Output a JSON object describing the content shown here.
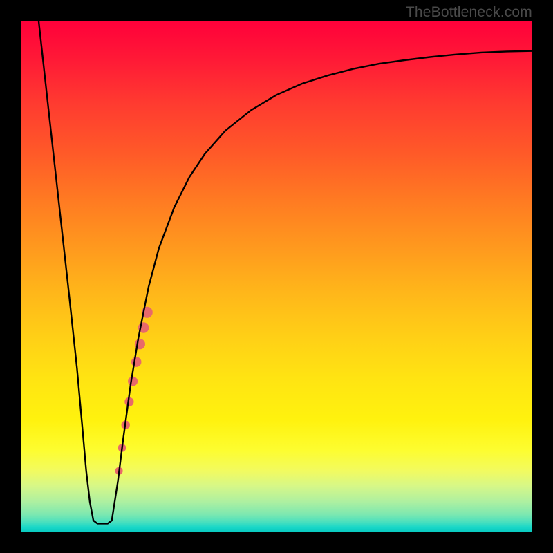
{
  "watermark": "TheBottleneck.com",
  "chart_data": {
    "type": "line",
    "title": "",
    "xlabel": "",
    "ylabel": "",
    "xlim": [
      0,
      100
    ],
    "ylim": [
      0,
      100
    ],
    "series": [
      {
        "name": "curve",
        "points": [
          [
            3.5,
            100
          ],
          [
            5.5,
            82
          ],
          [
            7.5,
            64
          ],
          [
            9.5,
            46
          ],
          [
            11,
            32
          ],
          [
            12,
            21
          ],
          [
            12.8,
            12
          ],
          [
            13.5,
            6
          ],
          [
            14.2,
            2.3
          ],
          [
            15,
            1.7
          ],
          [
            16,
            1.7
          ],
          [
            17,
            1.7
          ],
          [
            17.8,
            2.3
          ],
          [
            19,
            10
          ],
          [
            20,
            18
          ],
          [
            21.5,
            29
          ],
          [
            23,
            38
          ],
          [
            25,
            48
          ],
          [
            27,
            55.5
          ],
          [
            30,
            63.5
          ],
          [
            33,
            69.5
          ],
          [
            36,
            74
          ],
          [
            40,
            78.5
          ],
          [
            45,
            82.5
          ],
          [
            50,
            85.5
          ],
          [
            55,
            87.7
          ],
          [
            60,
            89.3
          ],
          [
            65,
            90.6
          ],
          [
            70,
            91.6
          ],
          [
            75,
            92.3
          ],
          [
            80,
            92.9
          ],
          [
            85,
            93.4
          ],
          [
            90,
            93.8
          ],
          [
            95,
            94.0
          ],
          [
            100,
            94.1
          ]
        ]
      }
    ],
    "highlight_dots": [
      {
        "x": 19.2,
        "y": 12,
        "r": 5.5
      },
      {
        "x": 19.8,
        "y": 16.5,
        "r": 5.8
      },
      {
        "x": 20.5,
        "y": 21,
        "r": 6.2
      },
      {
        "x": 21.2,
        "y": 25.5,
        "r": 6.6
      },
      {
        "x": 21.9,
        "y": 29.5,
        "r": 7.0
      },
      {
        "x": 22.6,
        "y": 33.3,
        "r": 7.3
      },
      {
        "x": 23.3,
        "y": 36.8,
        "r": 7.6
      },
      {
        "x": 24.0,
        "y": 40.0,
        "r": 7.8
      },
      {
        "x": 24.7,
        "y": 43.0,
        "r": 8.0
      }
    ],
    "colors": {
      "curve": "#000000",
      "dots": "#e86a6a",
      "gradient_top": "#ff003a",
      "gradient_bottom": "#06c9bf"
    }
  }
}
